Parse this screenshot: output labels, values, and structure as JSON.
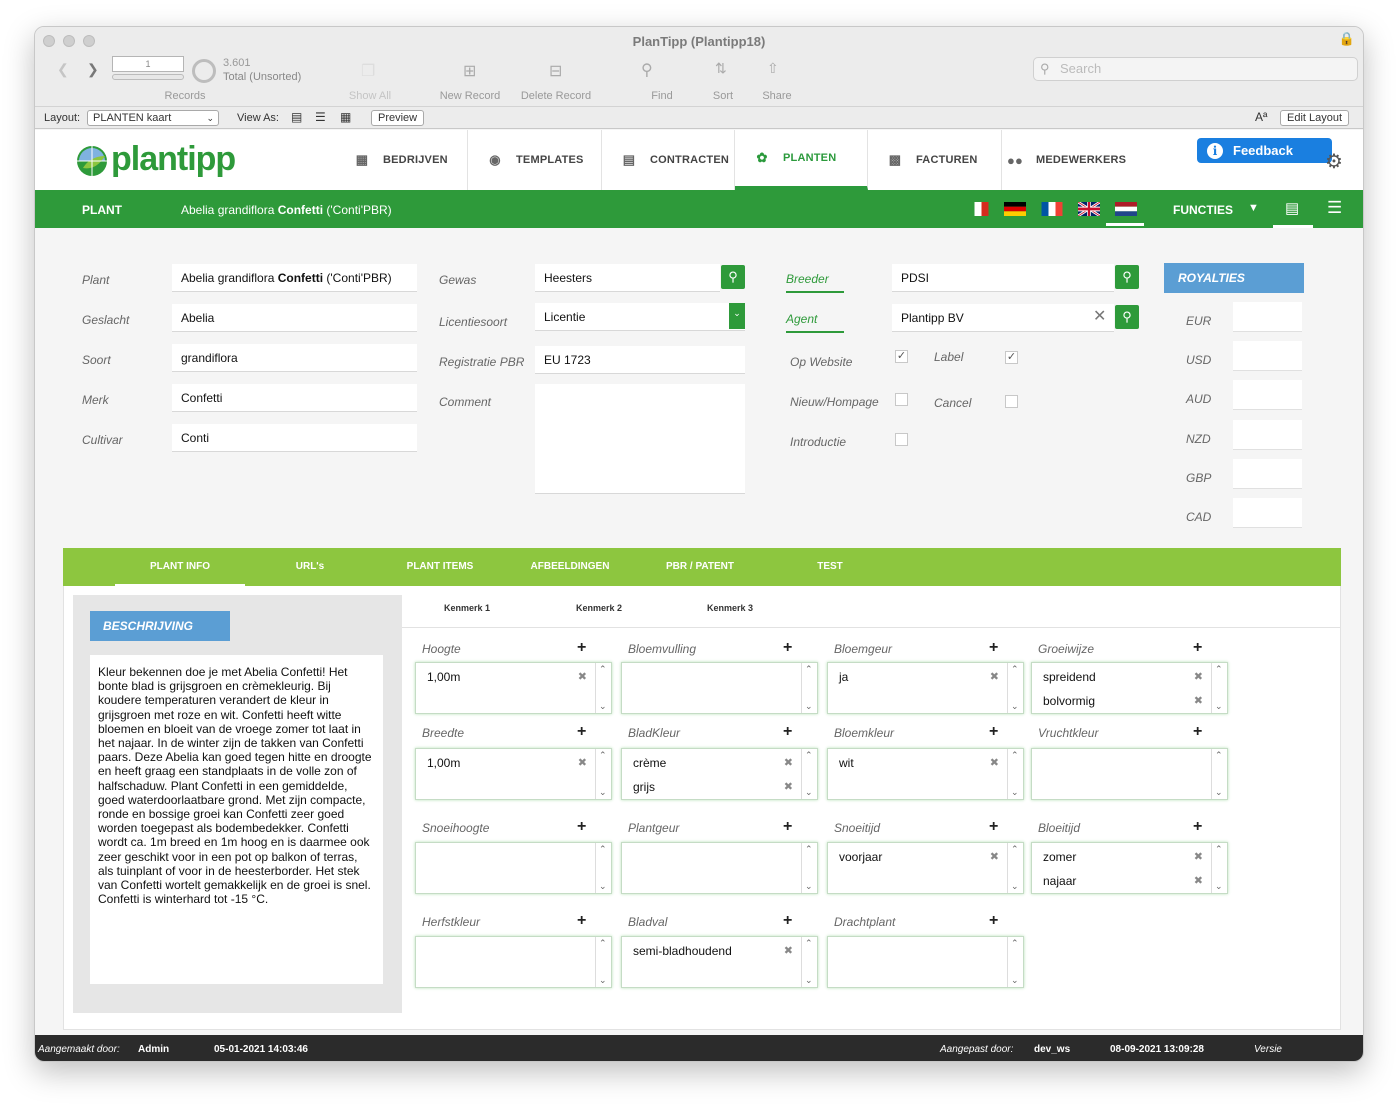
{
  "window": {
    "title": "PlanTipp (Plantipp18)"
  },
  "toolbar": {
    "record_number": "1",
    "record_count": "3.601",
    "record_status": "Total (Unsorted)",
    "records_label": "Records",
    "show_all": "Show All",
    "new_record": "New Record",
    "delete_record": "Delete Record",
    "find": "Find",
    "sort": "Sort",
    "share": "Share",
    "search_placeholder": "Search"
  },
  "layoutbar": {
    "layout_label": "Layout:",
    "layout_value": "PLANTEN kaart",
    "view_as": "View As:",
    "preview": "Preview",
    "font_icon": "Aª",
    "edit_layout": "Edit Layout"
  },
  "nav": {
    "logo": "plantipp",
    "items": [
      "BEDRIJVEN",
      "TEMPLATES",
      "CONTRACTEN",
      "PLANTEN",
      "FACTUREN",
      "MEDEWERKERS"
    ],
    "feedback": "Feedback"
  },
  "greenbar": {
    "section": "PLANT",
    "plant_name_prefix": "Abelia grandiflora ",
    "plant_name_bold": "Confetti",
    "plant_name_suffix": " ('Conti'PBR)",
    "functies": "FUNCTIES"
  },
  "form": {
    "labels": {
      "plant": "Plant",
      "geslacht": "Geslacht",
      "soort": "Soort",
      "merk": "Merk",
      "cultivar": "Cultivar",
      "gewas": "Gewas",
      "licentiesoort": "Licentiesoort",
      "registratie": "Registratie PBR",
      "comment": "Comment",
      "breeder": "Breeder",
      "agent": "Agent",
      "op_website": "Op Website",
      "label": "Label",
      "nieuw_homepage": "Nieuw/Hompage",
      "cancel": "Cancel",
      "introductie": "Introductie"
    },
    "values": {
      "plant_prefix": "Abelia grandiflora ",
      "plant_bold": "Confetti",
      "plant_suffix": " ('Conti'PBR)",
      "geslacht": "Abelia",
      "soort": "grandiflora",
      "merk": "Confetti",
      "cultivar": "Conti",
      "gewas": "Heesters",
      "licentiesoort": "Licentie",
      "registratie": "EU 1723",
      "comment": "",
      "breeder": "PDSI",
      "agent": "Plantipp BV"
    },
    "checks": {
      "op_website": true,
      "label": true,
      "nieuw_homepage": false,
      "cancel": false,
      "introductie": false
    }
  },
  "royalties": {
    "title": "ROYALTIES",
    "currencies": [
      "EUR",
      "USD",
      "AUD",
      "NZD",
      "GBP",
      "CAD"
    ]
  },
  "tabs": [
    "PLANT INFO",
    "URL's",
    "PLANT ITEMS",
    "AFBEELDINGEN",
    "PBR / PATENT",
    "TEST"
  ],
  "description": {
    "title": "BESCHRIJVING",
    "text": "Kleur bekennen doe je met Abelia Confetti! Het bonte blad is grijsgroen en crèmekleurig. Bij koudere temperaturen verandert de kleur in grijsgroen met roze en wit. Confetti heeft witte bloemen en bloeit van de vroege zomer tot laat in het najaar. In de winter zijn de takken van Confetti paars. Deze Abelia kan goed tegen hitte en droogte en heeft graag een standplaats in de volle zon of halfschaduw. Plant Confetti in een gemiddelde, goed waterdoorlaatbare grond. Met zijn compacte, ronde en bossige groei kan Confetti zeer goed worden toegepast als bodembedekker. Confetti wordt ca. 1m breed en 1m hoog en is daarmee ook zeer geschikt voor in een pot op balkon of terras, als tuinplant of voor in de heesterborder. Het stek van Confetti wortelt gemakkelijk en de groei is snel. Confetti is winterhard tot -15 °C."
  },
  "kenmerk_tabs": [
    "Kenmerk 1",
    "Kenmerk 2",
    "Kenmerk 3"
  ],
  "kenmerken": [
    {
      "label": "Hoogte",
      "items": [
        "1,00m"
      ]
    },
    {
      "label": "Bloemvulling",
      "items": []
    },
    {
      "label": "Bloemgeur",
      "items": [
        "ja"
      ]
    },
    {
      "label": "Groeiwijze",
      "items": [
        "spreidend",
        "bolvormig"
      ]
    },
    {
      "label": "Breedte",
      "items": [
        "1,00m"
      ]
    },
    {
      "label": "BladKleur",
      "items": [
        "crème",
        "grijs"
      ]
    },
    {
      "label": "Bloemkleur",
      "items": [
        "wit"
      ]
    },
    {
      "label": "Vruchtkleur",
      "items": []
    },
    {
      "label": "Snoeihoogte",
      "items": []
    },
    {
      "label": "Plantgeur",
      "items": []
    },
    {
      "label": "Snoeitijd",
      "items": [
        "voorjaar"
      ]
    },
    {
      "label": "Bloeitijd",
      "items": [
        "zomer",
        "najaar"
      ]
    },
    {
      "label": "Herfstkleur",
      "items": []
    },
    {
      "label": "Bladval",
      "items": [
        "semi-bladhoudend"
      ]
    },
    {
      "label": "Drachtplant",
      "items": []
    }
  ],
  "footer": {
    "created_label": "Aangemaakt door:",
    "created_by": "Admin",
    "created_at": "05-01-2021 14:03:46",
    "modified_label": "Aangepast door:",
    "modified_by": "dev_ws",
    "modified_at": "08-09-2021 13:09:28",
    "versie": "Versie"
  },
  "colors": {
    "green": "#2e9a3a",
    "lime": "#8dc63f",
    "blue": "#5b9ed4",
    "feedback": "#1a7fe0"
  }
}
